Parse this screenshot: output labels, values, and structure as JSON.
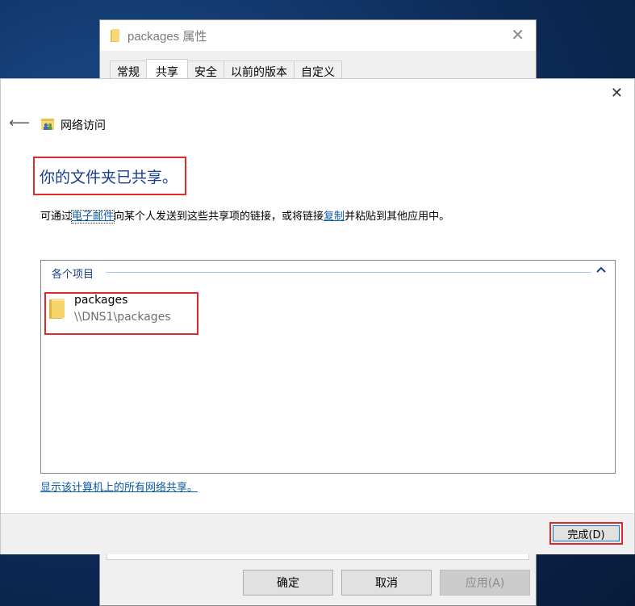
{
  "properties_window": {
    "title": "packages 属性",
    "tabs": [
      "常规",
      "共享",
      "安全",
      "以前的版本",
      "自定义"
    ],
    "buttons": {
      "ok": "确定",
      "cancel": "取消",
      "apply": "应用(A)"
    }
  },
  "dialog": {
    "nav_title": "网络访问",
    "heading": "你的文件夹已共享。",
    "description": {
      "part1": "可通过",
      "email_link": "电子邮件",
      "part2": "向某个人发送到这些共享项的链接，或将链接",
      "copy_link": "复制",
      "part3": "并粘贴到其他应用中。"
    },
    "items_group": {
      "header": "各个项目",
      "items": [
        {
          "name": "packages",
          "path": "\\\\DNS1\\packages"
        }
      ]
    },
    "show_all_link": "显示该计算机上的所有网络共享。",
    "done_button": "完成(D)"
  },
  "colors": {
    "heading": "#1a3c8c",
    "link": "#0a5aa8",
    "highlight_box": "#e02a2a"
  }
}
